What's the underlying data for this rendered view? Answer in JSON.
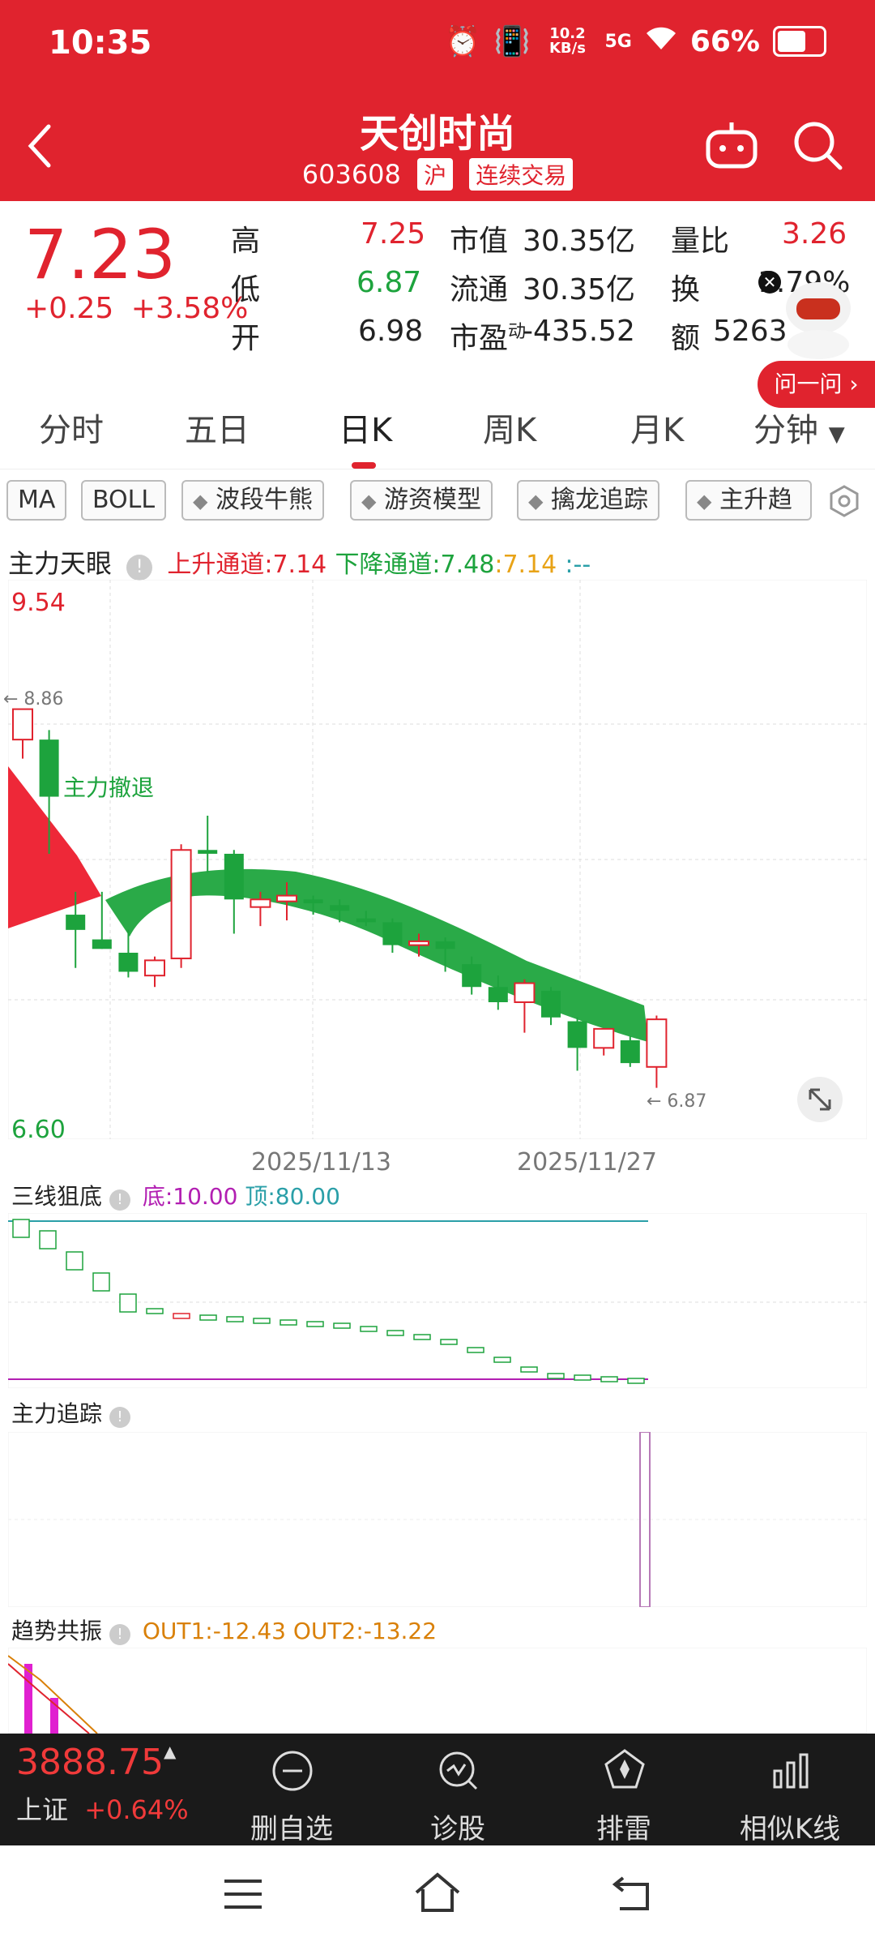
{
  "status_bar": {
    "time": "10:35",
    "net_speed": "10.2 KB/s",
    "network": "5G",
    "battery": "66%"
  },
  "header": {
    "title": "天创时尚",
    "code": "603608",
    "exchange": "沪",
    "trade_status": "连续交易"
  },
  "quote": {
    "price": "7.23",
    "change": "+0.25",
    "change_pct": "+3.58%",
    "high_label": "高",
    "high": "7.25",
    "low_label": "低",
    "low": "6.87",
    "open_label": "开",
    "open": "6.98",
    "mktcap_label": "市值",
    "mktcap": "30.35亿",
    "float_label": "流通",
    "float": "30.35亿",
    "pe_label": "市盈",
    "pe_sup": "动",
    "pe": "-435.52",
    "volratio_label": "量比",
    "volratio": "3.26",
    "turnover_label": "换",
    "turnover": "1.79%",
    "amount_label": "额",
    "amount": "5263"
  },
  "ask_button": "问一问",
  "tabs": [
    "分时",
    "五日",
    "日K",
    "周K",
    "月K",
    "分钟"
  ],
  "active_tab": "日K",
  "chips": [
    "MA",
    "BOLL",
    "波段牛熊",
    "游资模型",
    "擒龙追踪",
    "主升趋"
  ],
  "main_chart": {
    "title": "主力天眼",
    "up_channel": "上升通道:7.14",
    "down_channel": "下降通道:7.48",
    "extra_val": ":7.14",
    "extra_dash": ":--",
    "y_top": "9.54",
    "y_bottom": "6.60",
    "hi_marker": "← 8.86",
    "lo_marker": "← 6.87",
    "annotation": "主力撤退",
    "date_1": "2025/11/13",
    "date_2": "2025/11/27"
  },
  "chart_data": {
    "type": "candlestick",
    "y_range": [
      6.6,
      9.54
    ],
    "candles": [
      {
        "o": 8.86,
        "h": 8.86,
        "l": 8.6,
        "c": 8.7,
        "up": true
      },
      {
        "o": 8.7,
        "h": 8.75,
        "l": 8.1,
        "c": 8.4,
        "up": false
      },
      {
        "o": 7.78,
        "h": 7.9,
        "l": 7.5,
        "c": 7.7,
        "up": false
      },
      {
        "o": 7.65,
        "h": 7.9,
        "l": 7.6,
        "c": 7.6,
        "up": false
      },
      {
        "o": 7.58,
        "h": 7.7,
        "l": 7.45,
        "c": 7.48,
        "up": false
      },
      {
        "o": 7.46,
        "h": 7.56,
        "l": 7.4,
        "c": 7.54,
        "up": true
      },
      {
        "o": 7.55,
        "h": 8.15,
        "l": 7.5,
        "c": 8.12,
        "up": true
      },
      {
        "o": 8.1,
        "h": 8.3,
        "l": 8.0,
        "c": 8.12,
        "up": false
      },
      {
        "o": 8.1,
        "h": 8.12,
        "l": 7.68,
        "c": 7.86,
        "up": false
      },
      {
        "o": 7.82,
        "h": 7.9,
        "l": 7.72,
        "c": 7.86,
        "up": true
      },
      {
        "o": 7.85,
        "h": 7.95,
        "l": 7.75,
        "c": 7.88,
        "up": true
      },
      {
        "o": 7.86,
        "h": 7.88,
        "l": 7.78,
        "c": 7.84,
        "up": false
      },
      {
        "o": 7.83,
        "h": 7.86,
        "l": 7.74,
        "c": 7.8,
        "up": false
      },
      {
        "o": 7.76,
        "h": 7.8,
        "l": 7.72,
        "c": 7.74,
        "up": false
      },
      {
        "o": 7.74,
        "h": 7.76,
        "l": 7.58,
        "c": 7.62,
        "up": false
      },
      {
        "o": 7.62,
        "h": 7.68,
        "l": 7.56,
        "c": 7.64,
        "up": true
      },
      {
        "o": 7.64,
        "h": 7.66,
        "l": 7.48,
        "c": 7.6,
        "up": false
      },
      {
        "o": 7.52,
        "h": 7.56,
        "l": 7.36,
        "c": 7.4,
        "up": false
      },
      {
        "o": 7.4,
        "h": 7.46,
        "l": 7.28,
        "c": 7.32,
        "up": false
      },
      {
        "o": 7.32,
        "h": 7.44,
        "l": 7.16,
        "c": 7.42,
        "up": true
      },
      {
        "o": 7.38,
        "h": 7.4,
        "l": 7.2,
        "c": 7.24,
        "up": false
      },
      {
        "o": 7.22,
        "h": 7.24,
        "l": 6.96,
        "c": 7.08,
        "up": false
      },
      {
        "o": 7.08,
        "h": 7.18,
        "l": 7.04,
        "c": 7.18,
        "up": true
      },
      {
        "o": 7.12,
        "h": 7.14,
        "l": 6.98,
        "c": 7.0,
        "up": false
      },
      {
        "o": 6.98,
        "h": 7.25,
        "l": 6.87,
        "c": 7.23,
        "up": true
      }
    ]
  },
  "panel2": {
    "title": "三线狙底",
    "bottom": "底:10.00",
    "top": "顶:80.00"
  },
  "panel3": {
    "title": "主力追踪"
  },
  "panel4": {
    "title": "趋势共振",
    "out1": "OUT1:-12.43",
    "out2": "OUT2:-13.22"
  },
  "bottom_bar": {
    "index_value": "3888.75",
    "index_name": "上证",
    "index_change": "+0.64%",
    "items": [
      "删自选",
      "诊股",
      "排雷",
      "相似K线"
    ]
  }
}
